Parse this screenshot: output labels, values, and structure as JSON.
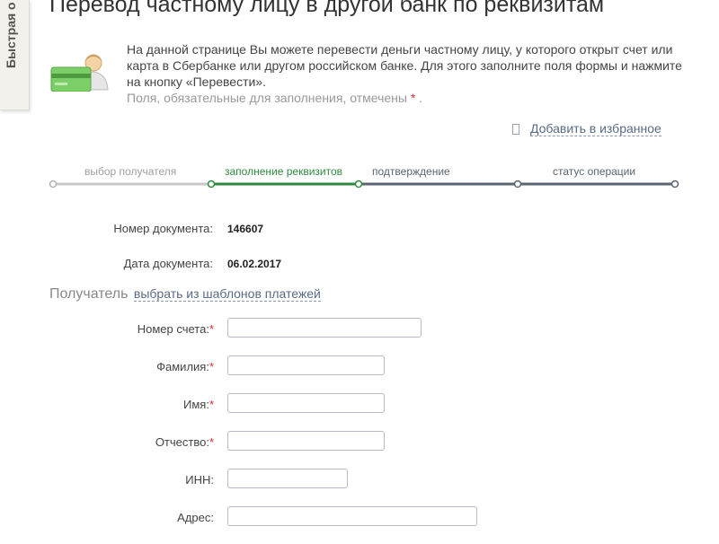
{
  "sidebar": {
    "quick_tab_label": "Быстрая о"
  },
  "page": {
    "title": "Перевод частному лицу в другой банк по реквизитам",
    "info_text": "На данной странице Вы можете перевести деньги частному лицу, у которого открыт счет или карта в Сбербанке или другом российском банке. Для этого заполните поля формы и нажмите на кнопку «Перевести».",
    "required_note_prefix": "Поля, обязательные для заполнения, отмечены",
    "required_star": "*",
    "required_note_suffix": ".",
    "add_to_favorites": "Добавить в избранное"
  },
  "steps": [
    {
      "label": "выбор получателя",
      "state": "done"
    },
    {
      "label": "заполнение реквизитов",
      "state": "active"
    },
    {
      "label": "подтверждение",
      "state": "pending"
    },
    {
      "label": "статус операции",
      "state": "pending"
    }
  ],
  "document": {
    "number_label": "Номер документа:",
    "number_value": "146607",
    "date_label": "Дата документа:",
    "date_value": "06.02.2017"
  },
  "recipient": {
    "section_title": "Получатель",
    "templates_link": "выбрать из шаблонов платежей",
    "fields": [
      {
        "label": "Номер счета:",
        "required": true,
        "value": ""
      },
      {
        "label": "Фамилия:",
        "required": true,
        "value": ""
      },
      {
        "label": "Имя:",
        "required": true,
        "value": ""
      },
      {
        "label": "Отчество:",
        "required": true,
        "value": ""
      },
      {
        "label": "ИНН:",
        "required": false,
        "value": ""
      },
      {
        "label": "Адрес:",
        "required": false,
        "value": ""
      }
    ]
  },
  "colors": {
    "accent_green": "#2e8b3d",
    "step_pending": "#5a6472",
    "step_done": "#c8c8c8",
    "required_red": "#d92e2e",
    "link_blue": "#5a6b85"
  }
}
